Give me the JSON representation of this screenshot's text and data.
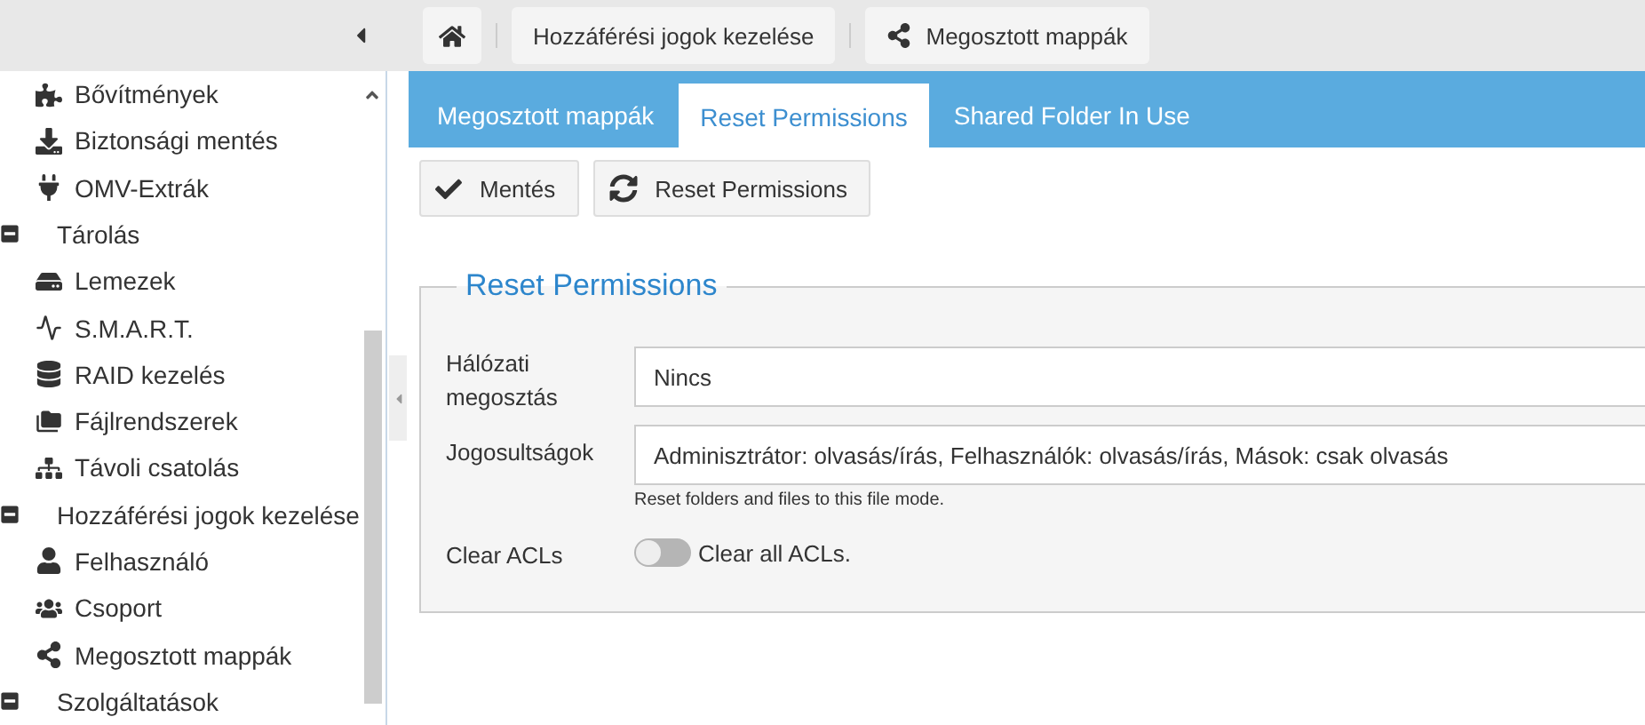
{
  "breadcrumb": {
    "items": [
      {
        "label": "Hozzáférési jogok kezelése"
      },
      {
        "label": "Megosztott mappák"
      }
    ]
  },
  "sidebar": {
    "top_items": [
      {
        "label": "Bővítmények"
      },
      {
        "label": "Biztonsági mentés"
      },
      {
        "label": "OMV-Extrák"
      }
    ],
    "groups": [
      {
        "label": "Tárolás",
        "expanded": true,
        "children": [
          {
            "label": "Lemezek"
          },
          {
            "label": "S.M.A.R.T."
          },
          {
            "label": "RAID kezelés"
          },
          {
            "label": "Fájlrendszerek"
          },
          {
            "label": "Távoli csatolás"
          }
        ]
      },
      {
        "label": "Hozzáférési jogok kezelése",
        "expanded": true,
        "children": [
          {
            "label": "Felhasználó"
          },
          {
            "label": "Csoport"
          },
          {
            "label": "Megosztott mappák"
          }
        ]
      },
      {
        "label": "Szolgáltatások",
        "expanded": true
      }
    ]
  },
  "tabs": [
    {
      "label": "Megosztott mappák",
      "selected": false
    },
    {
      "label": "Reset Permissions",
      "selected": true
    },
    {
      "label": "Shared Folder In Use",
      "selected": false
    }
  ],
  "toolbar": {
    "buttons": [
      {
        "label": "Mentés"
      },
      {
        "label": "Reset Permissions"
      }
    ]
  },
  "form": {
    "title": "Reset Permissions",
    "fields": [
      {
        "kind": "select",
        "label": "Hálózati megosztás",
        "value": "Nincs"
      },
      {
        "kind": "select",
        "label": "Jogosultságok",
        "value": "Adminisztrátor: olvasás/írás, Felhasználók: olvasás/írás, Mások: csak olvasás",
        "hint": "Reset folders and files to this file mode."
      },
      {
        "kind": "switch",
        "label": "Clear ACLs",
        "on": false,
        "text": "Clear all ACLs."
      }
    ]
  }
}
